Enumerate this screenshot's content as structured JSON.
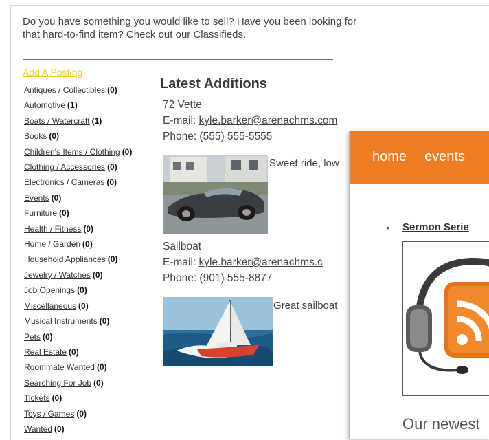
{
  "intro": {
    "line1": "Do you have something you would like to sell? Have you been looking for",
    "line2": "that hard-to-find item? Check out our Classifieds."
  },
  "add_posting": "Add A Posting",
  "categories": [
    {
      "label": "Antiques / Collectibles",
      "count": "(0)"
    },
    {
      "label": "Automotive",
      "count": "(1)"
    },
    {
      "label": "Boats / Watercraft",
      "count": "(1)"
    },
    {
      "label": "Books",
      "count": "(0)"
    },
    {
      "label": "Children's Items / Clothing",
      "count": "(0)"
    },
    {
      "label": "Clothing / Accessories",
      "count": "(0)"
    },
    {
      "label": "Electronics / Cameras",
      "count": "(0)"
    },
    {
      "label": "Events",
      "count": "(0)"
    },
    {
      "label": "Furniture",
      "count": "(0)"
    },
    {
      "label": "Health / Fitness",
      "count": "(0)"
    },
    {
      "label": "Home / Garden",
      "count": "(0)"
    },
    {
      "label": "Household Appliances",
      "count": "(0)"
    },
    {
      "label": "Jewelry / Watches",
      "count": "(0)"
    },
    {
      "label": "Job Openings",
      "count": "(0)"
    },
    {
      "label": "Miscellaneous",
      "count": "(0)"
    },
    {
      "label": "Musical Instruments",
      "count": "(0)"
    },
    {
      "label": "Pets",
      "count": "(0)"
    },
    {
      "label": "Real Estate",
      "count": "(0)"
    },
    {
      "label": "Roommate Wanted",
      "count": "(0)"
    },
    {
      "label": "Searching For Job",
      "count": "(0)"
    },
    {
      "label": "Tickets",
      "count": "(0)"
    },
    {
      "label": "Toys / Games",
      "count": "(0)"
    },
    {
      "label": "Wanted",
      "count": "(0)"
    }
  ],
  "latest": {
    "title": "Latest Additions",
    "items": [
      {
        "name": "72 Vette",
        "email_label": "E-mail:",
        "email": "kyle.barker@arenachms.com",
        "phone": "Phone: (555) 555-5555",
        "description": "Sweet ride, low"
      },
      {
        "name": "Sailboat",
        "email_label": "E-mail:",
        "email": "kyle.barker@arenachms.c",
        "phone": "Phone: (901) 555-8877",
        "description": "Great sailboat"
      }
    ]
  },
  "overlay": {
    "nav": [
      "home",
      "events"
    ],
    "series_link": "Sermon Serie",
    "newest_text": "Our newest"
  },
  "colors": {
    "accent_orange": "#ef7d23",
    "add_posting_yellow": "#f0d02a"
  }
}
